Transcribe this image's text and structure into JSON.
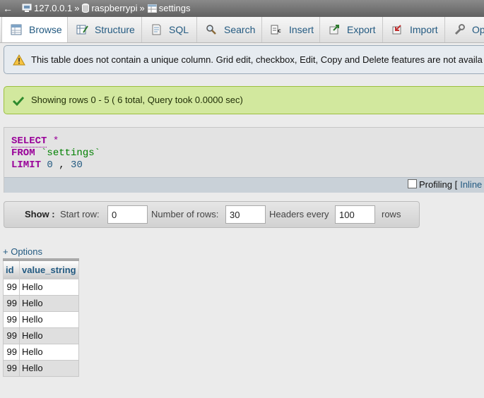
{
  "breadcrumb": {
    "back_glyph": "←",
    "server": "127.0.0.1",
    "database": "raspberrypi",
    "table": "settings",
    "separator": "»"
  },
  "tabs": [
    {
      "label": "Browse",
      "icon": "browse-icon",
      "active": true
    },
    {
      "label": "Structure",
      "icon": "structure-icon"
    },
    {
      "label": "SQL",
      "icon": "sql-icon"
    },
    {
      "label": "Search",
      "icon": "search-icon"
    },
    {
      "label": "Insert",
      "icon": "insert-icon"
    },
    {
      "label": "Export",
      "icon": "export-icon"
    },
    {
      "label": "Import",
      "icon": "import-icon"
    },
    {
      "label": "Op",
      "icon": "operations-icon"
    }
  ],
  "warning_notice": "This table does not contain a unique column. Grid edit, checkbox, Edit, Copy and Delete features are not availa",
  "success_notice": "Showing rows 0 - 5 ( 6 total, Query took 0.0000 sec)",
  "sql": {
    "select_kw": "SELECT",
    "star": "*",
    "from_kw": "FROM",
    "table_name": "`settings`",
    "limit_kw": "LIMIT",
    "limit_offset": "0",
    "limit_sep": ",",
    "limit_count": "30"
  },
  "profiling": {
    "label": "Profiling [",
    "inline_link": "Inline"
  },
  "show_bar": {
    "show_label": "Show :",
    "start_row_label": "Start row:",
    "start_row_value": "0",
    "num_rows_label": "Number of rows:",
    "num_rows_value": "30",
    "headers_every_label": "Headers every",
    "headers_every_value": "100",
    "rows_label": "rows"
  },
  "options_link": "+ Options",
  "table": {
    "columns": [
      "id",
      "value_string"
    ],
    "rows": [
      [
        "99",
        "Hello"
      ],
      [
        "99",
        "Hello"
      ],
      [
        "99",
        "Hello"
      ],
      [
        "99",
        "Hello"
      ],
      [
        "99",
        "Hello"
      ],
      [
        "99",
        "Hello"
      ]
    ]
  },
  "colors": {
    "link": "#235a81",
    "sql_keyword": "#990099",
    "sql_string": "#008000",
    "success_bg": "#d2e89e",
    "warning_bg": "#e6ebf0"
  }
}
